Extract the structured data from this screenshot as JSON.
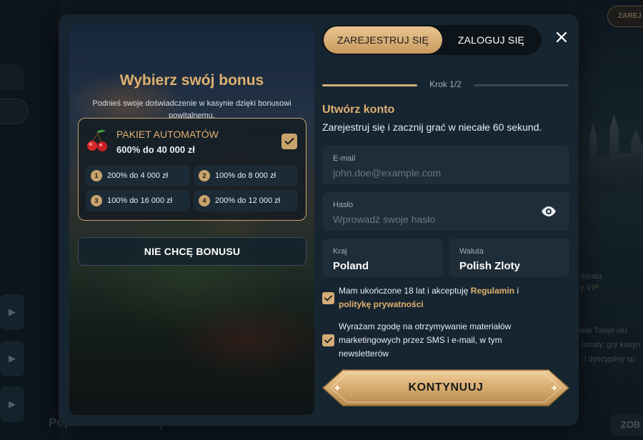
{
  "background": {
    "top_badge": "ZAREJ",
    "right_snippets": [
      "onusu.",
      "rstkie Twoje ulu",
      "omaty, gry kasyn",
      "i dyscypliny sp"
    ],
    "vip_snippet": "y VIP.",
    "bottom_title": "Popularne automaty",
    "bottom_button": "ZOB"
  },
  "bonus": {
    "title": "Wybierz swój bonus",
    "subtitle": "Podnieś swoje doświadczenie w kasynie dzięki bonusowi powitalnemu.",
    "package": {
      "name": "PAKIET AUTOMATÓW",
      "amount": "600% do 40 000 zł",
      "selected": true,
      "tiers": [
        {
          "num": "1",
          "label": "200% do 4 000 zł"
        },
        {
          "num": "2",
          "label": "100% do 8 000 zł"
        },
        {
          "num": "3",
          "label": "100% do 16 000 zł"
        },
        {
          "num": "4",
          "label": "200% do 12 000 zł"
        }
      ]
    },
    "no_bonus_label": "NIE CHCĘ BONUSU"
  },
  "tabs": {
    "register": "ZAREJESTRUJ SIĘ",
    "login": "ZALOGUJ SIĘ"
  },
  "step": {
    "label": "Krok 1/2",
    "progress": 0.5
  },
  "form": {
    "title": "Utwórz konto",
    "subtitle": "Zarejestruj się i zacznij grać w niecałe 60 sekund.",
    "email": {
      "label": "E-mail",
      "placeholder": "john.doe@example.com"
    },
    "password": {
      "label": "Hasło",
      "placeholder": "Wprowadź swoje hasło"
    },
    "country": {
      "label": "Kraj",
      "value": "Poland"
    },
    "currency": {
      "label": "Waluta",
      "value": "Polish Zloty"
    },
    "consent_terms": {
      "text_before": "Mam ukończone 18 lat i akceptuję ",
      "link1": "Regulamin",
      "text_mid": " i ",
      "link2": "politykę prywatności",
      "checked": true
    },
    "consent_marketing": {
      "text": "Wyrażam zgodę na otrzymywanie materiałów marketingowych przez SMS i e-mail, w tym newsletterów",
      "checked": true
    },
    "continue_label": "KONTYNUUJ"
  },
  "colors": {
    "accent_gold": "#e0b070",
    "button_gold": "#d4ac78",
    "modal_bg": "#172530",
    "field_bg": "#1f2d38"
  }
}
